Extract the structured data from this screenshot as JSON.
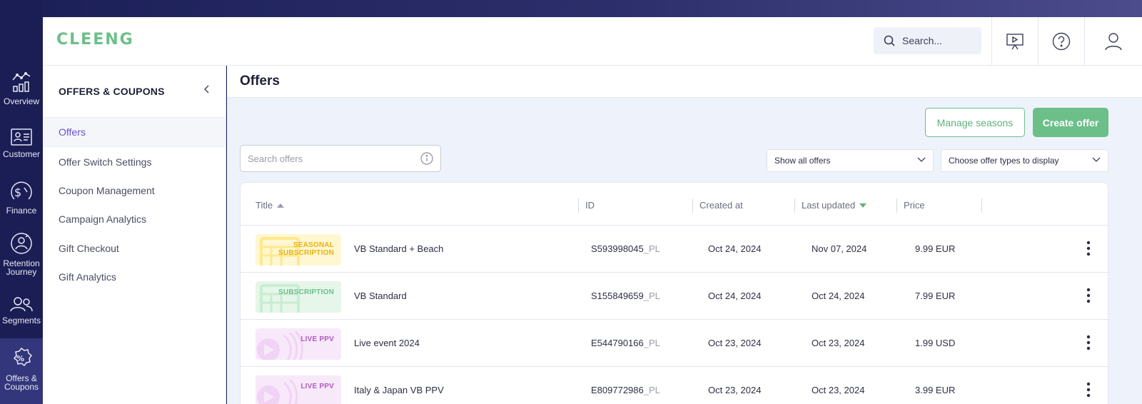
{
  "brand": {
    "logo_text": "CLEENG",
    "accent": "#6cbf89",
    "nav_bg": "#1b1e55"
  },
  "rail": [
    {
      "label": "Overview",
      "icon": "overview-chart-icon"
    },
    {
      "label": "Customer",
      "icon": "customer-card-icon"
    },
    {
      "label": "Finance",
      "icon": "finance-dollar-icon"
    },
    {
      "label": "Retention Journey",
      "icon": "retention-journey-icon"
    },
    {
      "label": "Segments",
      "icon": "segments-users-icon"
    },
    {
      "label": "Offers & Coupons",
      "icon": "offers-percent-icon",
      "active": true
    }
  ],
  "header": {
    "search_placeholder": "Search..."
  },
  "subnav": {
    "title": "OFFERS & COUPONS",
    "items": [
      {
        "label": "Offers",
        "active": true
      },
      {
        "label": "Offer Switch Settings"
      },
      {
        "label": "Coupon Management"
      },
      {
        "label": "Campaign Analytics"
      },
      {
        "label": "Gift Checkout"
      },
      {
        "label": "Gift Analytics"
      }
    ]
  },
  "main": {
    "title": "Offers",
    "manage_seasons": "Manage seasons",
    "create_offer": "Create offer",
    "search_placeholder": "Search offers",
    "filter_offers": "Show all offers",
    "filter_types": "Choose offer types to display"
  },
  "table": {
    "columns": {
      "title": "Title",
      "id": "ID",
      "created": "Created at",
      "updated": "Last updated",
      "price": "Price"
    },
    "rows": [
      {
        "type": "seasonal",
        "badge1": "SEASONAL",
        "badge2": "SUBSCRIPTION",
        "title": "VB Standard + Beach",
        "id": "S593998045",
        "suffix": "_PL",
        "created": "Oct 24, 2024",
        "updated": "Nov 07, 2024",
        "price": "9.99 EUR"
      },
      {
        "type": "subscription",
        "badge1": "SUBSCRIPTION",
        "badge2": "",
        "title": "VB Standard",
        "id": "S155849659",
        "suffix": "_PL",
        "created": "Oct 24, 2024",
        "updated": "Oct 24, 2024",
        "price": "7.99 EUR"
      },
      {
        "type": "ppv",
        "badge1": "LIVE PPV",
        "badge2": "",
        "title": "Live event 2024",
        "id": "E544790166",
        "suffix": "_PL",
        "created": "Oct 23, 2024",
        "updated": "Oct 23, 2024",
        "price": "1.99 USD"
      },
      {
        "type": "ppv",
        "badge1": "LIVE PPV",
        "badge2": "",
        "title": "Italy & Japan VB PPV",
        "id": "E809772986",
        "suffix": "_PL",
        "created": "Oct 23, 2024",
        "updated": "Oct 23, 2024",
        "price": "3.99 EUR"
      }
    ]
  }
}
